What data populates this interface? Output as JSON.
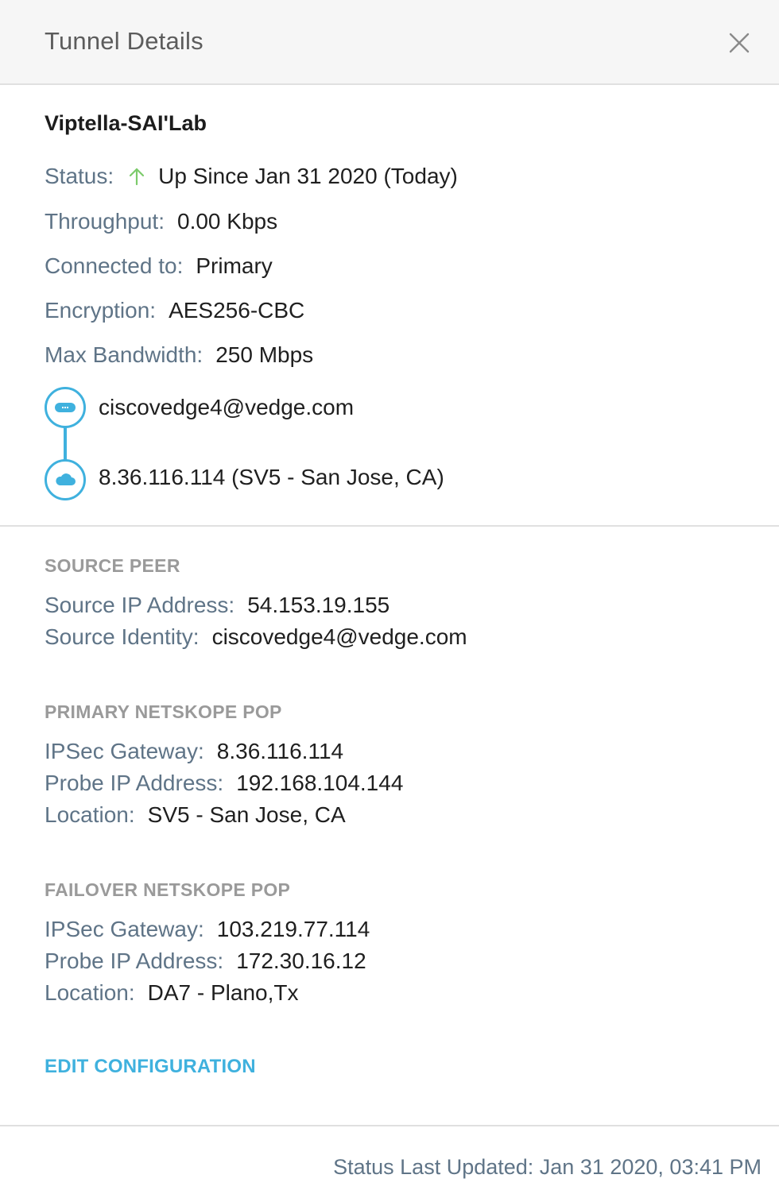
{
  "header": {
    "title": "Tunnel Details"
  },
  "tunnel": {
    "name": "Viptella-SAI'Lab",
    "status_label": "Status:",
    "status_value": "Up Since Jan 31 2020 (Today)",
    "throughput_label": "Throughput:",
    "throughput_value": "0.00 Kbps",
    "connected_label": "Connected to:",
    "connected_value": "Primary",
    "encryption_label": "Encryption:",
    "encryption_value": "AES256-CBC",
    "bandwidth_label": "Max Bandwidth:",
    "bandwidth_value": "250 Mbps",
    "path_source": "ciscovedge4@vedge.com",
    "path_destination": "8.36.116.114 (SV5 - San Jose, CA)"
  },
  "source_peer": {
    "heading": "SOURCE PEER",
    "ip_label": "Source IP Address:",
    "ip_value": "54.153.19.155",
    "identity_label": "Source Identity:",
    "identity_value": "ciscovedge4@vedge.com"
  },
  "primary_pop": {
    "heading": "PRIMARY NETSKOPE POP",
    "gateway_label": "IPSec Gateway:",
    "gateway_value": "8.36.116.114",
    "probe_label": "Probe IP Address:",
    "probe_value": "192.168.104.144",
    "location_label": "Location:",
    "location_value": "SV5 - San Jose, CA"
  },
  "failover_pop": {
    "heading": "FAILOVER NETSKOPE POP",
    "gateway_label": "IPSec Gateway:",
    "gateway_value": "103.219.77.114",
    "probe_label": "Probe IP Address:",
    "probe_value": "172.30.16.12",
    "location_label": "Location:",
    "location_value": "DA7 - Plano,Tx"
  },
  "actions": {
    "edit_label": "EDIT CONFIGURATION"
  },
  "footer": {
    "status_updated": "Status Last Updated: Jan 31 2020, 03:41 PM"
  },
  "colors": {
    "accent": "#3fb1de",
    "status_up": "#7ccb6b",
    "label": "#5f7487"
  },
  "icons": {
    "close": "close-icon",
    "status": "arrow-up-icon",
    "source": "server-icon",
    "destination": "cloud-icon"
  }
}
